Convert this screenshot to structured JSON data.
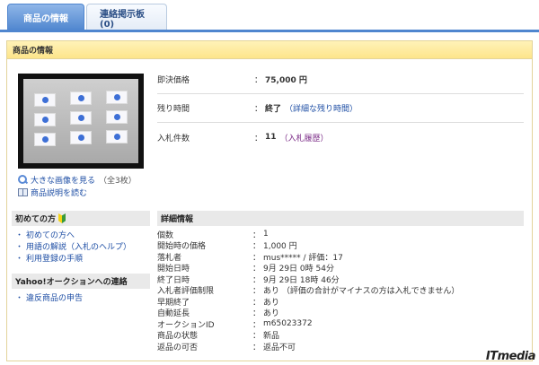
{
  "tabs": [
    {
      "label": "商品の情報",
      "active": true
    },
    {
      "label": "連絡掲示板(0)",
      "active": false
    }
  ],
  "panel": {
    "title": "商品の情報"
  },
  "photo": {
    "link_label": "大きな画像を見る",
    "count_note": "（全3枚）",
    "desc_label": "商品説明を読む"
  },
  "summary": {
    "price_label": "即決価格",
    "price_value": "75,000 円",
    "time_label": "残り時間",
    "time_value": "終了",
    "time_link": "（詳細な残り時間）",
    "bids_label": "入札件数",
    "bids_value": "11",
    "bids_link": "（入札履歴）"
  },
  "beginner": {
    "title": "初めての方",
    "items": [
      "初めての方へ",
      "用語の解説（入札のヘルプ）",
      "利用登録の手順"
    ]
  },
  "contact": {
    "title": "Yahoo!オークションへの連絡",
    "items": [
      "違反商品の申告"
    ]
  },
  "detail": {
    "title": "詳細情報",
    "colon": "：",
    "rows": [
      {
        "label": "個数",
        "value": "1"
      },
      {
        "label": "開始時の価格",
        "value": "1,000 円"
      },
      {
        "label": "落札者",
        "value": "mus***** / 評価：17"
      },
      {
        "label": "開始日時",
        "value": "9月 29日 0時 54分"
      },
      {
        "label": "終了日時",
        "value": "9月 29日 18時 46分"
      },
      {
        "label": "入札者評価制限",
        "value": "あり （評価の合計がマイナスの方は入札できません）"
      },
      {
        "label": "早期終了",
        "value": "あり"
      },
      {
        "label": "自動延長",
        "value": "あり"
      },
      {
        "label": "オークションID",
        "value": "m65023372"
      },
      {
        "label": "商品の状態",
        "value": "新品"
      },
      {
        "label": "返品の可否",
        "value": "返品不可"
      }
    ]
  },
  "watermark": "ITmedia",
  "colors": {
    "tab_active": "#4f86cf",
    "panel_header": "#fde58a",
    "link": "#1f4fa5",
    "link_visited": "#7a2a86"
  }
}
